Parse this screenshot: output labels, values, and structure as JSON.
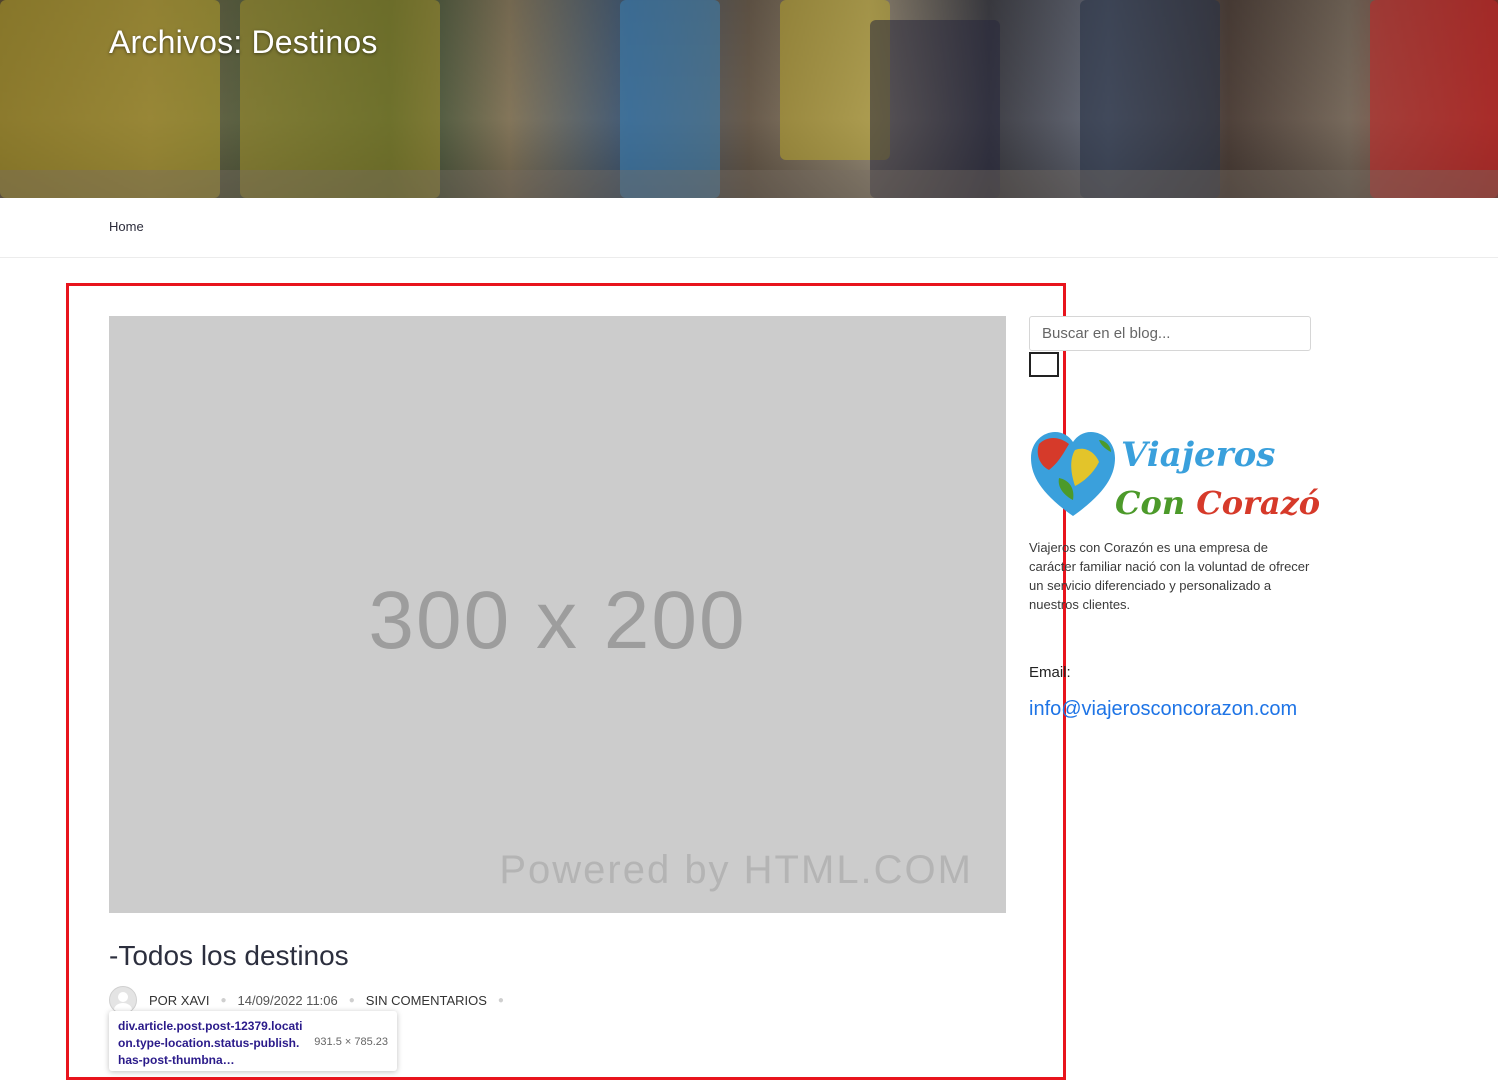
{
  "hero": {
    "title": "Archivos: Destinos"
  },
  "breadcrumb": {
    "home": "Home"
  },
  "post": {
    "thumbnail_size_text": "300 x 200",
    "thumbnail_powered_text": "Powered by HTML.COM",
    "title": "-Todos los destinos",
    "author": "POR XAVI",
    "date": "14/09/2022 11:06",
    "comments": "SIN COMENTARIOS"
  },
  "inspector_tooltip": {
    "selector": "div.article.post.post-12379.location.type-location.status-publish.has-post-thumbna…",
    "dimensions": "931.5 × 785.23"
  },
  "sidebar": {
    "search_placeholder": "Buscar en el blog...",
    "logo_line1": "Viajeros",
    "logo_line2": "Con Corazón",
    "about_text": "Viajeros con Corazón es una empresa de carácter familiar nació con la voluntad de ofrecer un servicio diferenciado y personalizado a nuestros clientes.",
    "email_label": "Email:",
    "email_value": "info@viajerosconcorazon.com"
  },
  "colors": {
    "highlight_border": "#e8141d",
    "email_link": "#1e74e6",
    "logo_blue": "#3aa0dc",
    "logo_green": "#4c9a2a",
    "logo_red": "#d63a2a"
  }
}
